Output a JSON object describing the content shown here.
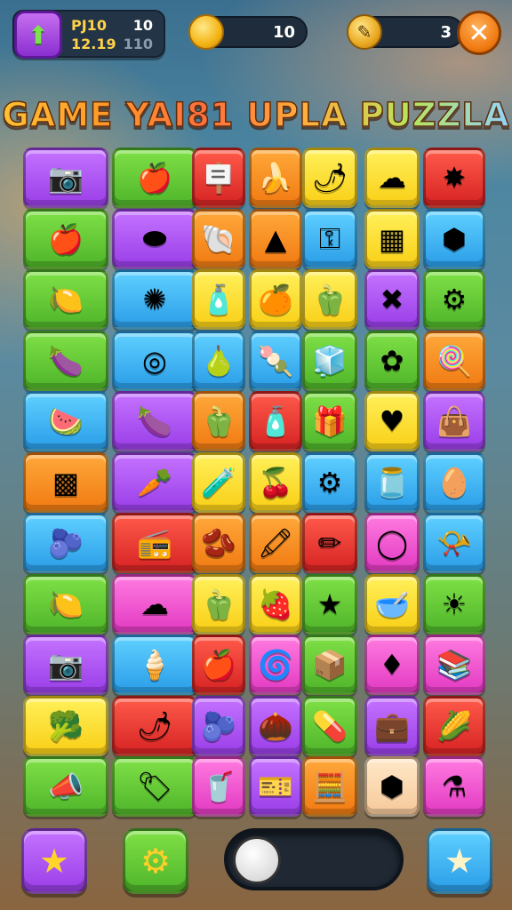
{
  "hud": {
    "level_label_1": "PJ10",
    "level_label_2": "12.19",
    "level_value_1": "10",
    "level_value_2": "110",
    "coins": "10",
    "tools": "3"
  },
  "title": "GAME YAI81 UPLA PUZZLA",
  "colors": {
    "purple": "#a94af0",
    "green": "#5ec232",
    "red": "#e33434",
    "orange": "#f58a20",
    "yellow": "#fbdb2a",
    "blue": "#3ab1ee",
    "magenta": "#ee4acb",
    "peach": "#f8d6ad"
  },
  "board": {
    "rows": [
      [
        {
          "c": "purple",
          "i": "camera"
        },
        {
          "c": "green",
          "i": "apple"
        },
        {
          "c": "red",
          "i": "sign"
        },
        {
          "c": "orange",
          "i": "banana"
        },
        {
          "c": "yellow",
          "i": "chili"
        },
        {
          "c": "yellow",
          "i": "cloud"
        },
        {
          "c": "red",
          "i": "star-blob"
        }
      ],
      [
        {
          "c": "green",
          "i": "apple"
        },
        {
          "c": "purple",
          "i": "blob"
        },
        {
          "c": "orange",
          "i": "shell"
        },
        {
          "c": "orange",
          "i": "cone"
        },
        {
          "c": "blue",
          "i": "key"
        },
        {
          "c": "yellow",
          "i": "box"
        },
        {
          "c": "blue",
          "i": "cube"
        }
      ],
      [
        {
          "c": "green",
          "i": "lemon"
        },
        {
          "c": "blue",
          "i": "splat"
        },
        {
          "c": "yellow",
          "i": "bottle"
        },
        {
          "c": "yellow",
          "i": "orange-fruit"
        },
        {
          "c": "yellow",
          "i": "pepper"
        },
        {
          "c": "purple",
          "i": "knot"
        },
        {
          "c": "green",
          "i": "gear"
        }
      ],
      [
        {
          "c": "green",
          "i": "eggplant"
        },
        {
          "c": "blue",
          "i": "donut"
        },
        {
          "c": "blue",
          "i": "pear"
        },
        {
          "c": "blue",
          "i": "popsicle"
        },
        {
          "c": "green",
          "i": "ice-pop"
        },
        {
          "c": "green",
          "i": "flower"
        },
        {
          "c": "orange",
          "i": "lollipop"
        }
      ],
      [
        {
          "c": "blue",
          "i": "melon"
        },
        {
          "c": "purple",
          "i": "eggplant"
        },
        {
          "c": "orange",
          "i": "pepper"
        },
        {
          "c": "red",
          "i": "bottle"
        },
        {
          "c": "green",
          "i": "gift"
        },
        {
          "c": "yellow",
          "i": "heart"
        },
        {
          "c": "purple",
          "i": "bag"
        }
      ],
      [
        {
          "c": "orange",
          "i": "waffle"
        },
        {
          "c": "purple",
          "i": "carrot"
        },
        {
          "c": "yellow",
          "i": "spray"
        },
        {
          "c": "yellow",
          "i": "cherry"
        },
        {
          "c": "blue",
          "i": "cog"
        },
        {
          "c": "blue",
          "i": "jar"
        },
        {
          "c": "blue",
          "i": "egg"
        }
      ],
      [
        {
          "c": "blue",
          "i": "plum"
        },
        {
          "c": "red",
          "i": "radio"
        },
        {
          "c": "orange",
          "i": "bean"
        },
        {
          "c": "orange",
          "i": "crayon"
        },
        {
          "c": "red",
          "i": "pencil"
        },
        {
          "c": "magenta",
          "i": "ring"
        },
        {
          "c": "blue",
          "i": "horn"
        }
      ],
      [
        {
          "c": "green",
          "i": "lemon"
        },
        {
          "c": "magenta",
          "i": "cloud"
        },
        {
          "c": "yellow",
          "i": "bell-pepper"
        },
        {
          "c": "yellow",
          "i": "strawberry"
        },
        {
          "c": "green",
          "i": "star"
        },
        {
          "c": "yellow",
          "i": "bowl"
        },
        {
          "c": "green",
          "i": "sun"
        }
      ],
      [
        {
          "c": "purple",
          "i": "camera"
        },
        {
          "c": "blue",
          "i": "ice-cream"
        },
        {
          "c": "red",
          "i": "apple"
        },
        {
          "c": "magenta",
          "i": "snail"
        },
        {
          "c": "green",
          "i": "crate"
        },
        {
          "c": "magenta",
          "i": "gem"
        },
        {
          "c": "magenta",
          "i": "books"
        }
      ],
      [
        {
          "c": "yellow",
          "i": "broccoli"
        },
        {
          "c": "red",
          "i": "chili"
        },
        {
          "c": "purple",
          "i": "berry"
        },
        {
          "c": "purple",
          "i": "acorn"
        },
        {
          "c": "green",
          "i": "pill"
        },
        {
          "c": "purple",
          "i": "briefcase"
        },
        {
          "c": "red",
          "i": "corn"
        }
      ],
      [
        {
          "c": "green",
          "i": "whistle"
        },
        {
          "c": "green",
          "i": "tag"
        },
        {
          "c": "magenta",
          "i": "cup"
        },
        {
          "c": "purple",
          "i": "ticket"
        },
        {
          "c": "orange",
          "i": "calc"
        },
        {
          "c": "peach",
          "i": "cube"
        },
        {
          "c": "magenta",
          "i": "potion"
        }
      ]
    ]
  },
  "bottom": {
    "left_icon": "star-icon",
    "gear_icon": "gear-icon",
    "right_icon": "star-icon"
  }
}
